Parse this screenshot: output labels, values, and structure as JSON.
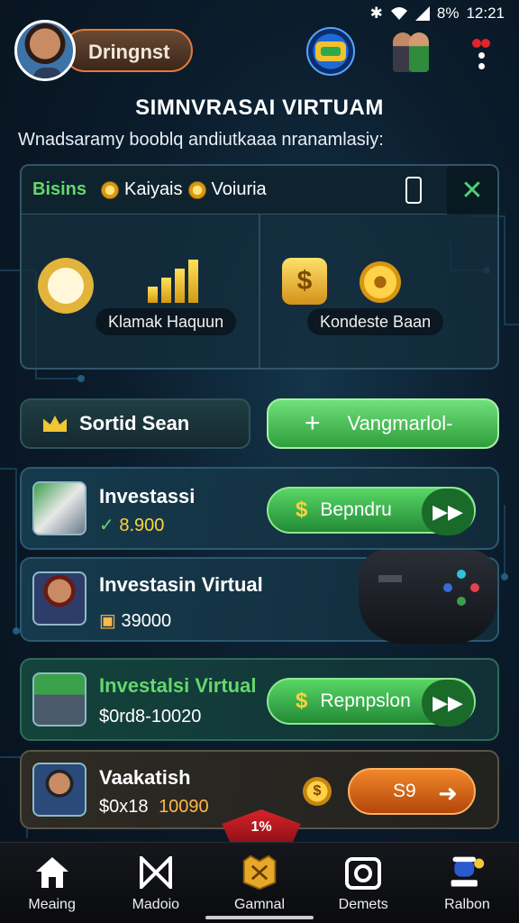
{
  "status_bar": {
    "battery": "8%",
    "time": "12:21"
  },
  "header": {
    "username": "Dringnst",
    "title": "SIMNVRASAI VIRTUAM",
    "subtitle": "Wnadsaramy booblq andiutkaaa nranamlasiy:"
  },
  "info_panel": {
    "tab_label": "Bisins",
    "tag_1": "Kaiyais",
    "tag_2": "Voiuria",
    "left_label": "Klamak Haquun",
    "right_label": "Kondeste Baan"
  },
  "actions": {
    "dark_button": "Sortid Sean",
    "green_button": "Vangmarlol-",
    "plus": "+"
  },
  "cards": [
    {
      "title": "Investassi",
      "amount": "8.900",
      "action": "Bepndru",
      "action_style": "green"
    },
    {
      "title": "Investasin Virtual",
      "amount": "39000",
      "action": "",
      "action_style": "none"
    },
    {
      "title": "Investalsi Virtual",
      "amount": "$0rd8-10020",
      "action": "Repnpslon",
      "action_style": "green"
    },
    {
      "title": "Vaakatish",
      "amount_prefix": "$0x18",
      "amount": "10090",
      "action": "S9",
      "action_style": "orange"
    }
  ],
  "ribbon": "1%",
  "bottom_nav": [
    {
      "label": "Meaing",
      "icon": "home-icon"
    },
    {
      "label": "Madoio",
      "icon": "bowtie-icon"
    },
    {
      "label": "Gamnal",
      "icon": "trophy-icon"
    },
    {
      "label": "Demets",
      "icon": "camera-icon"
    },
    {
      "label": "Ralbon",
      "icon": "chef-icon"
    }
  ],
  "colors": {
    "accent_green": "#4caf50",
    "accent_orange": "#e07a2a",
    "background": "#0b1c2c",
    "gold": "#f2c12e"
  }
}
